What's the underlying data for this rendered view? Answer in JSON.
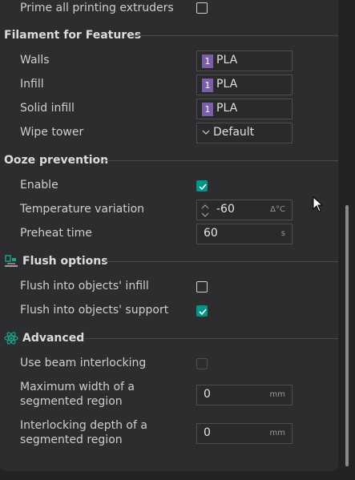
{
  "prime": {
    "label": "Prime all printing extruders",
    "checked": false
  },
  "filament_section": {
    "title": "Filament for Features",
    "rows": [
      {
        "label": "Walls",
        "badge": "1",
        "value": "PLA"
      },
      {
        "label": "Infill",
        "badge": "1",
        "value": "PLA"
      },
      {
        "label": "Solid infill",
        "badge": "1",
        "value": "PLA"
      }
    ],
    "wipe_tower": {
      "label": "Wipe tower",
      "value": "Default"
    }
  },
  "ooze_section": {
    "title": "Ooze prevention",
    "enable": {
      "label": "Enable",
      "checked": true
    },
    "temp_variation": {
      "label": "Temperature variation",
      "value": "-60",
      "unit": "Δ°C"
    },
    "preheat_time": {
      "label": "Preheat time",
      "value": "60",
      "unit": "s"
    }
  },
  "flush_section": {
    "title": "Flush options",
    "infill": {
      "label": "Flush into objects' infill",
      "checked": false
    },
    "support": {
      "label": "Flush into objects' support",
      "checked": true
    }
  },
  "advanced_section": {
    "title": "Advanced",
    "beam": {
      "label": "Use beam interlocking",
      "checked": false,
      "disabled": true
    },
    "max_width": {
      "label_line1": "Maximum width of a",
      "label_line2": "segmented region",
      "value": "0",
      "unit": "mm"
    },
    "depth": {
      "label_line1": "Interlocking depth of a",
      "label_line2": "segmented region",
      "value": "0",
      "unit": "mm"
    }
  },
  "colors": {
    "accent": "#009688",
    "badge": "#7b5ea7"
  }
}
